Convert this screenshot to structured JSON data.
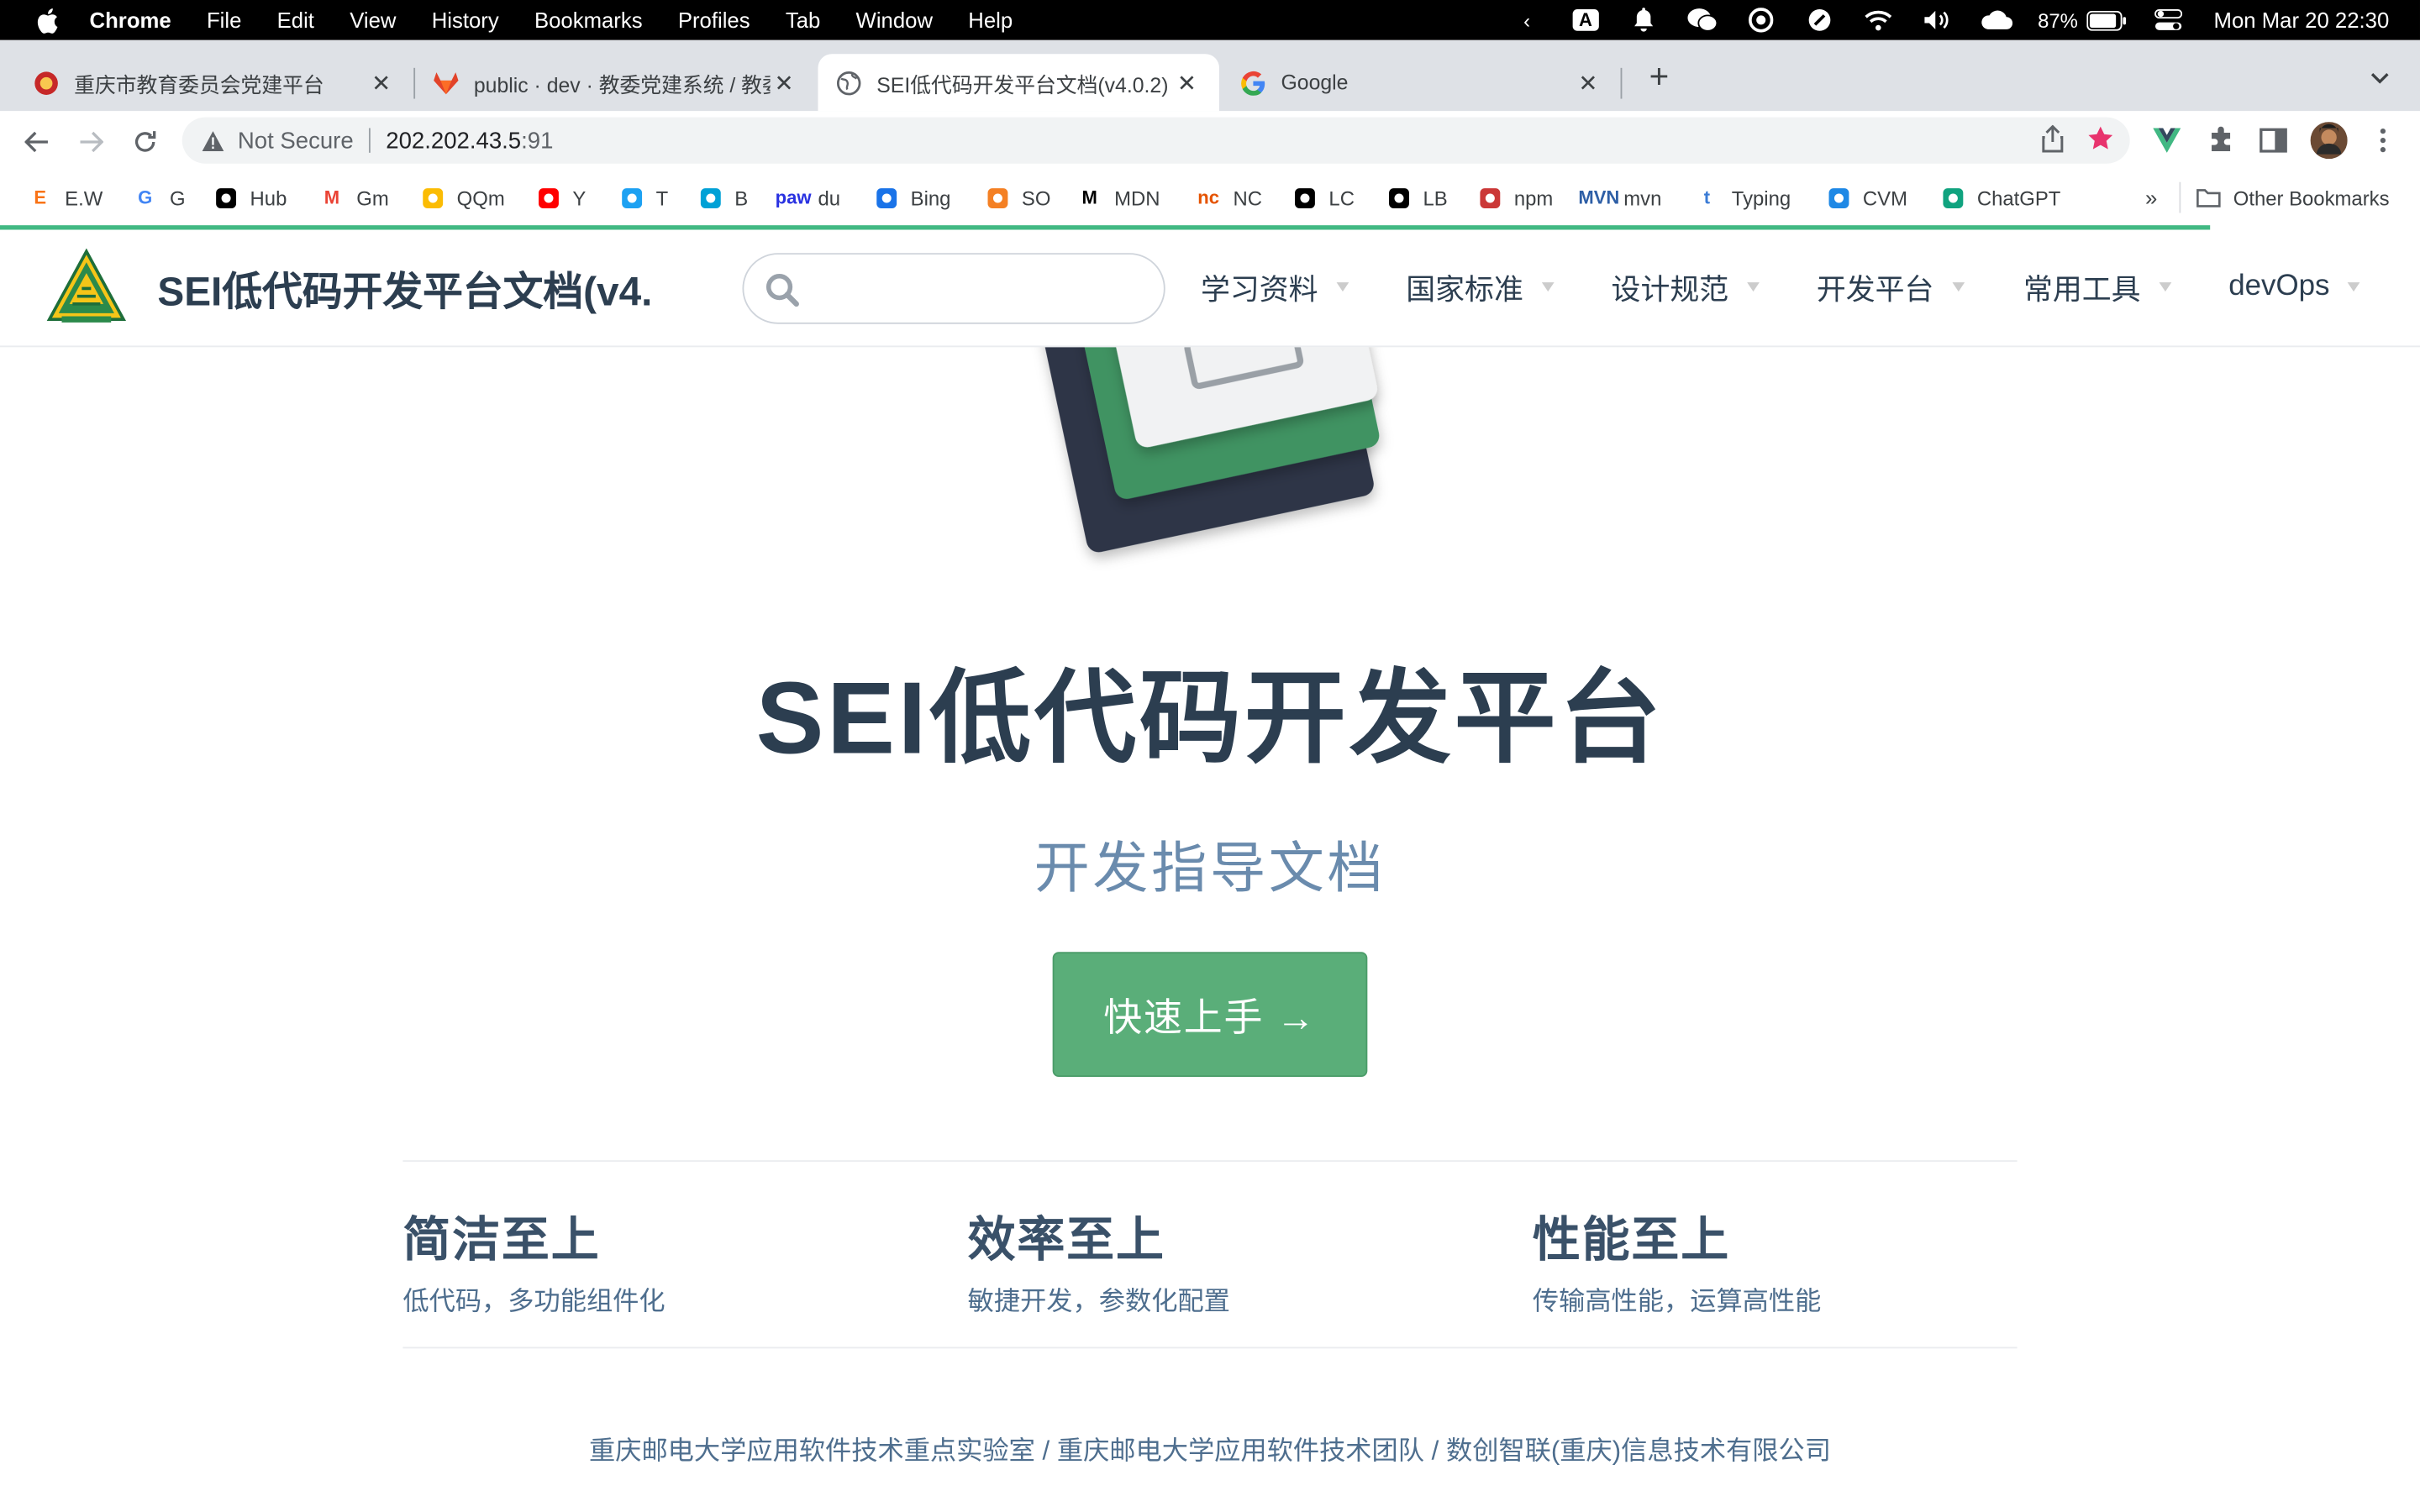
{
  "menubar": {
    "app": "Chrome",
    "items": [
      "File",
      "Edit",
      "View",
      "History",
      "Bookmarks",
      "Profiles",
      "Tab",
      "Window",
      "Help"
    ],
    "input_source": "A",
    "battery": "87%",
    "datetime": "Mon Mar 20  22:30"
  },
  "tabs": [
    {
      "title": "重庆市教育委员会党建平台",
      "icon": "party-emblem-icon"
    },
    {
      "title": "public · dev · 教委党建系统 / 教委",
      "icon": "gitlab-icon"
    },
    {
      "title": "SEI低代码开发平台文档(v4.0.2)",
      "icon": "globe-icon",
      "active": true
    },
    {
      "title": "Google",
      "icon": "google-icon"
    }
  ],
  "toolbar": {
    "security": "Not Secure",
    "url_host": "202.202.43.5",
    "url_port": ":91"
  },
  "bookmarks": {
    "items": [
      {
        "label": "E.W",
        "icon": "E",
        "color": "#f97316"
      },
      {
        "label": "G",
        "icon": "G",
        "color": "#4285f4"
      },
      {
        "label": "Hub",
        "icon": "github",
        "color": "#000000"
      },
      {
        "label": "Gm",
        "icon": "M",
        "color": "#ea4335"
      },
      {
        "label": "QQm",
        "icon": "chrome",
        "color": "#fbbc04"
      },
      {
        "label": "Y",
        "icon": "youtube",
        "color": "#ff0000"
      },
      {
        "label": "T",
        "icon": "twitter",
        "color": "#1da1f2"
      },
      {
        "label": "B",
        "icon": "bilibili",
        "color": "#00a1d6"
      },
      {
        "label": "du",
        "icon": "paw",
        "color": "#2932e1"
      },
      {
        "label": "Bing",
        "icon": "search",
        "color": "#1a73e8"
      },
      {
        "label": "SO",
        "icon": "stack",
        "color": "#f48024"
      },
      {
        "label": "MDN",
        "icon": "M",
        "color": "#000000"
      },
      {
        "label": "NC",
        "icon": "nc",
        "color": "#e55300"
      },
      {
        "label": "LC",
        "icon": "leetcode",
        "color": "#000000"
      },
      {
        "label": "LB",
        "icon": "leetcode",
        "color": "#000000"
      },
      {
        "label": "npm",
        "icon": "npm",
        "color": "#cb3837"
      },
      {
        "label": "mvn",
        "icon": "MVN",
        "color": "#2e5fa6"
      },
      {
        "label": "Typing",
        "icon": "t",
        "color": "#3a7bd5"
      },
      {
        "label": "CVM",
        "icon": "cloud",
        "color": "#1e88e5"
      },
      {
        "label": "ChatGPT",
        "icon": "openai",
        "color": "#10a37f"
      }
    ],
    "overflow": "»",
    "other": "Other Bookmarks"
  },
  "site": {
    "title": "SEI低代码开发平台文档(v4.",
    "search_placeholder": "",
    "nav": [
      "学习资料",
      "国家标准",
      "设计规范",
      "开发平台",
      "常用工具",
      "devOps"
    ]
  },
  "hero": {
    "title": "SEI低代码开发平台",
    "description": "开发指导文档",
    "cta": "快速上手 →"
  },
  "features": [
    {
      "title": "简洁至上",
      "details": "低代码，多功能组件化"
    },
    {
      "title": "效率至上",
      "details": "敏捷开发，参数化配置"
    },
    {
      "title": "性能至上",
      "details": "传输高性能，运算高性能"
    }
  ],
  "footer": "重庆邮电大学应用软件技术重点实验室 / 重庆邮电大学应用软件技术团队 / 数创智联(重庆)信息技术有限公司",
  "colors": {
    "accent": "#42b983",
    "cta": "#5aae79",
    "text": "#2c3e50",
    "subtext": "#6a8bad"
  },
  "progress": 0.913
}
